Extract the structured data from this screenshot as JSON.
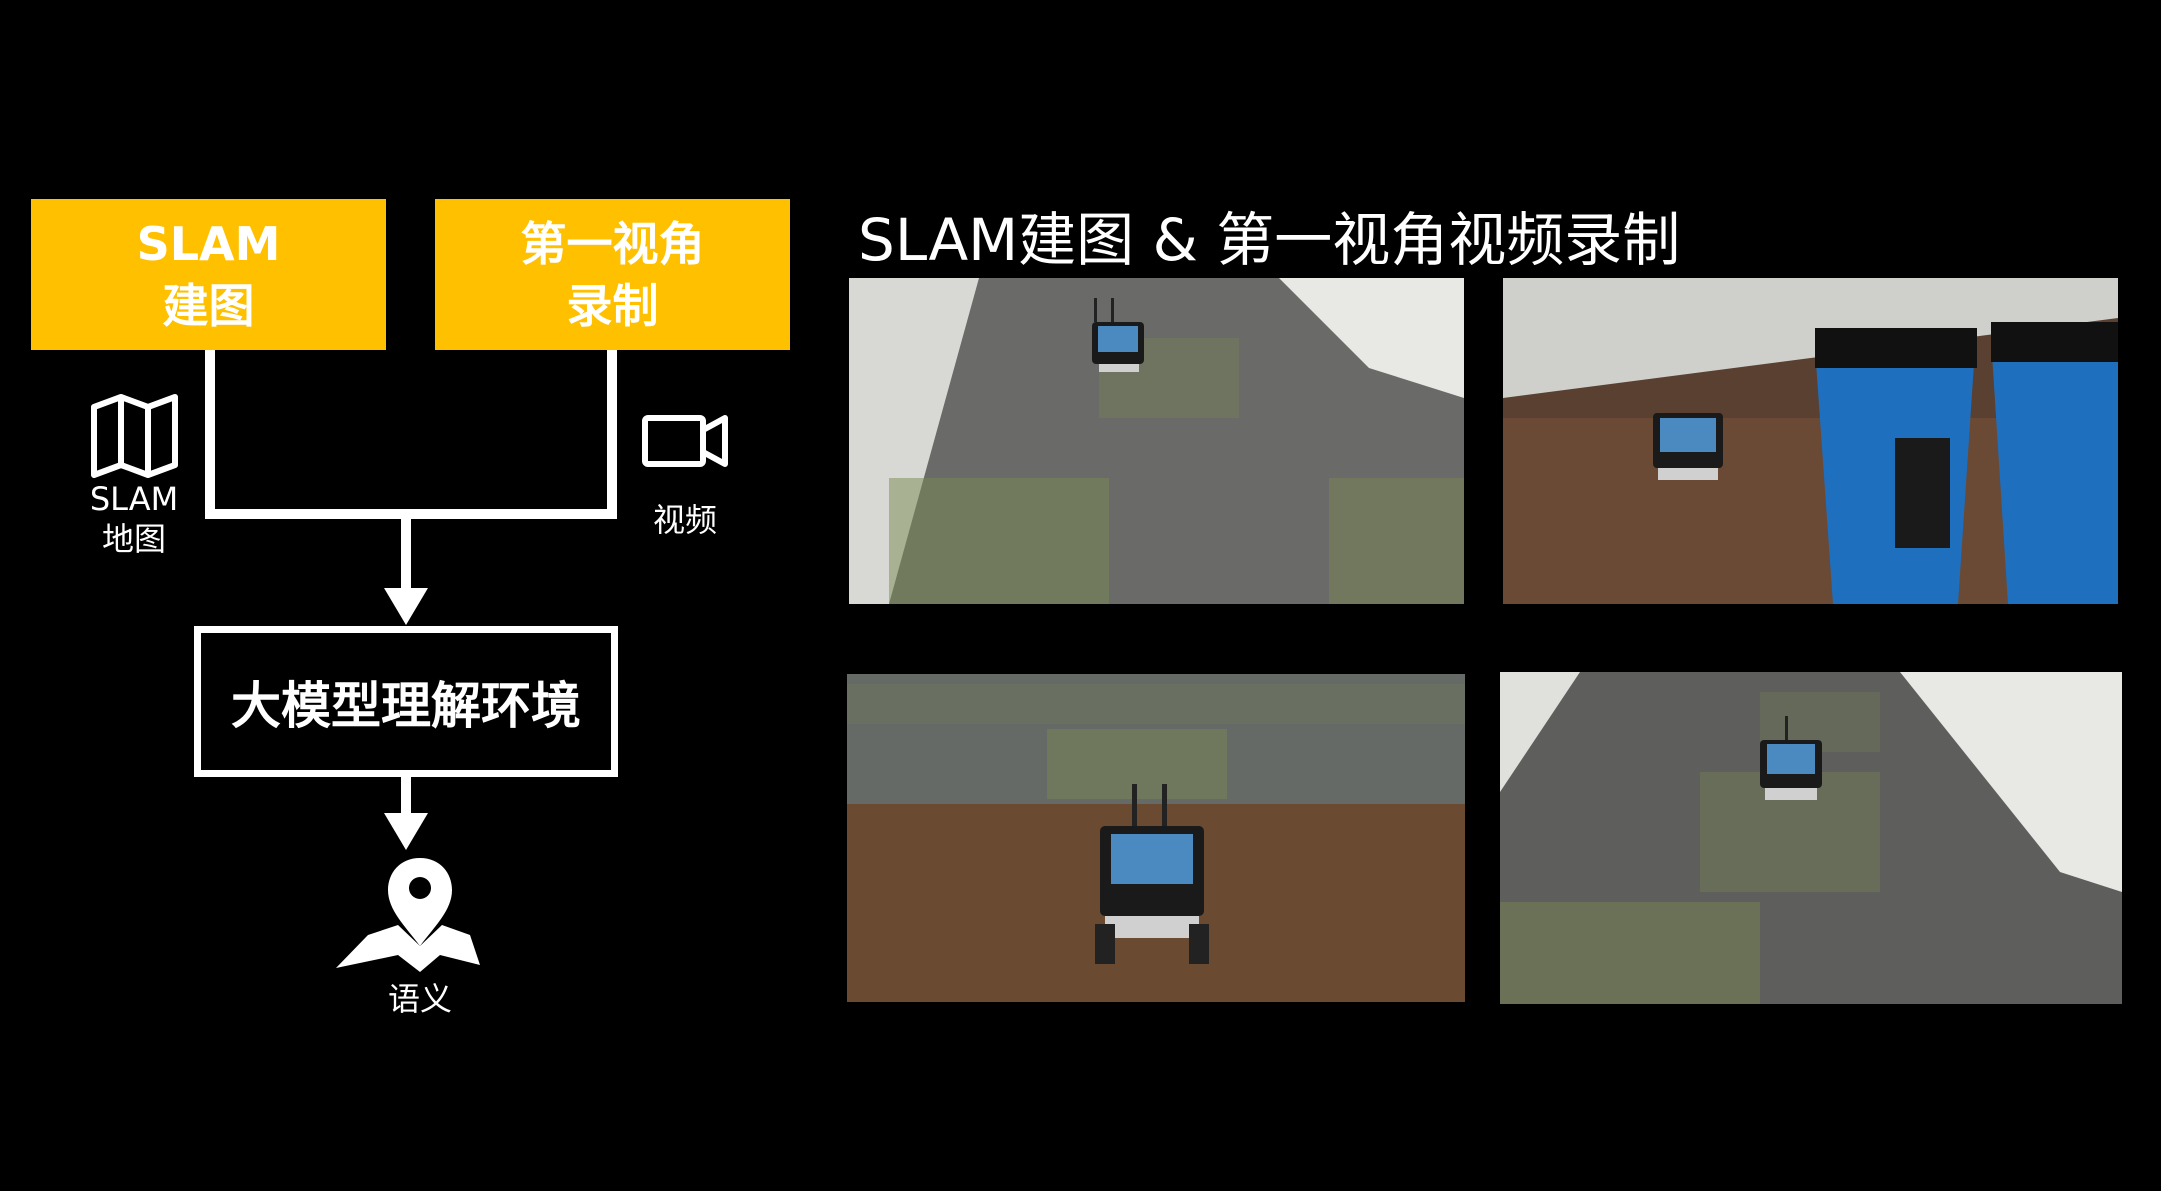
{
  "title": "SLAM建图 & 第一视角视频录制",
  "left_diagram": {
    "box_slam": {
      "line1": "SLAM",
      "line2": "建图"
    },
    "box_video": {
      "line1": "第一视角",
      "line2": "录制"
    },
    "map_caption": {
      "line1": "SLAM",
      "line2": "地图"
    },
    "video_caption": "视频",
    "center_box": "大模型理解环境",
    "semantic_caption": "语义"
  },
  "colors": {
    "accent_yellow": "#FFC000",
    "background": "#000000",
    "foreground": "#FFFFFF"
  },
  "icons": [
    "map-icon",
    "video-camera-icon",
    "location-pin-icon"
  ]
}
